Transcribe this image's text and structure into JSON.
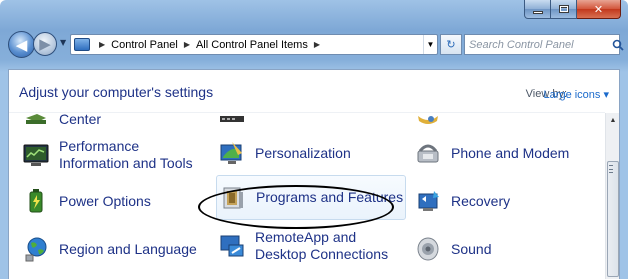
{
  "window": {
    "caption_buttons": [
      "minimize",
      "maximize",
      "close"
    ]
  },
  "navigation": {
    "back_icon": "back-arrow-icon",
    "forward_icon": "forward-arrow-icon",
    "breadcrumbs": [
      "Control Panel",
      "All Control Panel Items"
    ],
    "search_placeholder": "Search Control Panel"
  },
  "header": {
    "title": "Adjust your computer's settings",
    "view_by_label": "View by:",
    "view_by_value": "Large icons ▾"
  },
  "items": [
    {
      "label": "Center",
      "icon": "action-center-flag-icon"
    },
    {
      "label": "",
      "icon": "partial-device-icon"
    },
    {
      "label": "",
      "icon": "partial-folder-icon"
    },
    {
      "label": "Performance Information and Tools",
      "icon": "performance-meter-icon"
    },
    {
      "label": "Personalization",
      "icon": "personalization-icon"
    },
    {
      "label": "Phone and Modem",
      "icon": "phone-modem-icon"
    },
    {
      "label": "Power Options",
      "icon": "power-options-icon"
    },
    {
      "label": "Programs and Features",
      "icon": "programs-features-icon"
    },
    {
      "label": "Recovery",
      "icon": "recovery-icon"
    },
    {
      "label": "Region and Language",
      "icon": "region-language-globe-icon"
    },
    {
      "label": "RemoteApp and Desktop Connections",
      "icon": "remoteapp-icon"
    },
    {
      "label": "Sound",
      "icon": "sound-speaker-icon"
    }
  ],
  "colors": {
    "link": "#1e3287",
    "frame": "#7ea8d6",
    "highlight": "#eaf3fc",
    "close_button": "#c2381c"
  }
}
